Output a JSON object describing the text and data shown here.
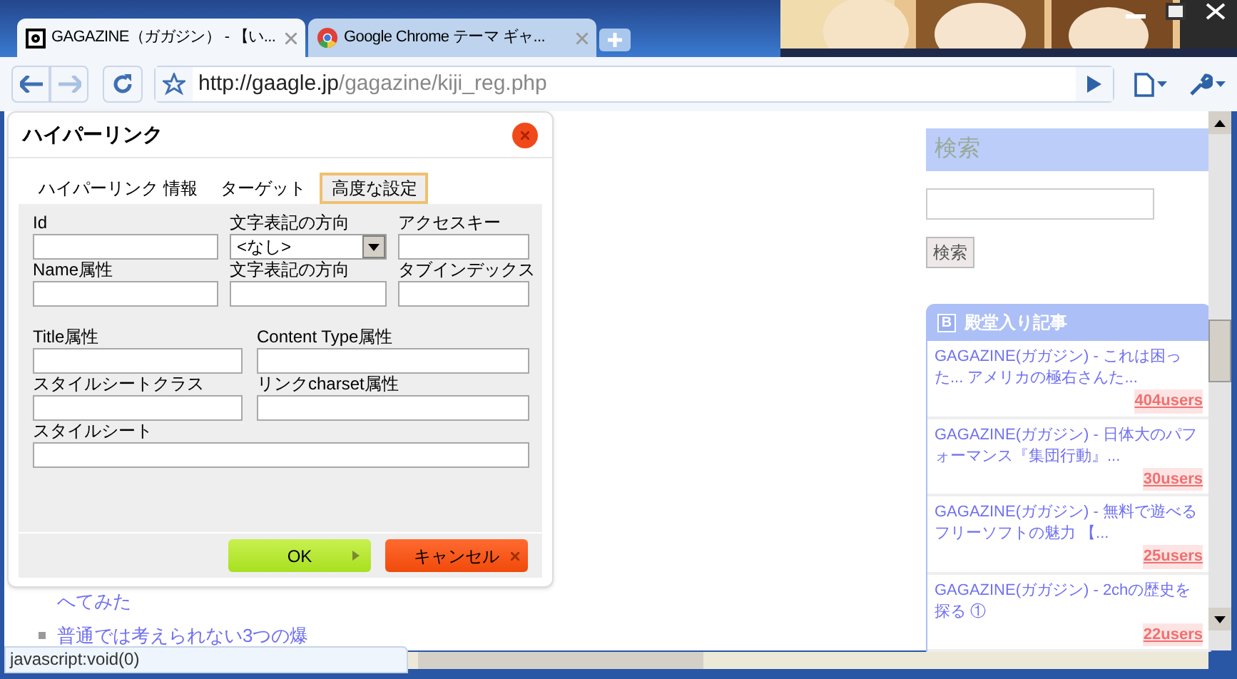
{
  "browser": {
    "tabs": [
      {
        "title": "GAGAZINE（ガガジン） - 【い...",
        "selected": true
      },
      {
        "title": "Google Chrome テーマ ギャ...",
        "selected": false
      }
    ],
    "url_host": "http://gaagle.jp",
    "url_path": "/gagazine/kiji_reg.php"
  },
  "page": {
    "list_items": [
      {
        "text": "へてみた",
        "bullet": false
      },
      {
        "text": "普通では考えられない3つの爆",
        "bullet": true
      }
    ],
    "search": {
      "heading": "検索",
      "button": "検索"
    },
    "ranking": {
      "badge": "B",
      "heading": "殿堂入り記事",
      "articles": [
        {
          "title": "GAGAZINE(ガガジン) - これは困った... アメリカの極右さんた...",
          "users": "404users"
        },
        {
          "title": "GAGAZINE(ガガジン) - 日体大のパフォーマンス『集団行動』...",
          "users": "30users"
        },
        {
          "title": "GAGAZINE(ガガジン) - 無料で遊べるフリーソフトの魅力 【...",
          "users": "25users"
        },
        {
          "title": "GAGAZINE(ガガジン) - 2chの歴史を探る ①",
          "users": "22users"
        }
      ]
    }
  },
  "dialog": {
    "title": "ハイパーリンク",
    "tabs": [
      {
        "label": "ハイパーリンク 情報",
        "selected": false
      },
      {
        "label": "ターゲット",
        "selected": false
      },
      {
        "label": "高度な設定",
        "selected": true
      }
    ],
    "rows": [
      [
        {
          "label": "Id",
          "kind": "text"
        },
        {
          "label": "文字表記の方向",
          "kind": "select",
          "value": "<なし>"
        },
        {
          "label": "アクセスキー",
          "kind": "text"
        }
      ],
      [
        {
          "label": "Name属性",
          "kind": "text"
        },
        {
          "label": "文字表記の方向",
          "kind": "text"
        },
        {
          "label": "タブインデックス",
          "kind": "text"
        }
      ],
      [
        {
          "label": "Title属性",
          "kind": "text"
        },
        {
          "label": "Content Type属性",
          "kind": "text"
        }
      ],
      [
        {
          "label": "スタイルシートクラス",
          "kind": "text"
        },
        {
          "label": "リンクcharset属性",
          "kind": "text"
        }
      ],
      [
        {
          "label": "スタイルシート",
          "kind": "text"
        }
      ]
    ],
    "ok": "OK",
    "cancel": "キャンセル"
  },
  "status_bar": "javascript:void(0)"
}
